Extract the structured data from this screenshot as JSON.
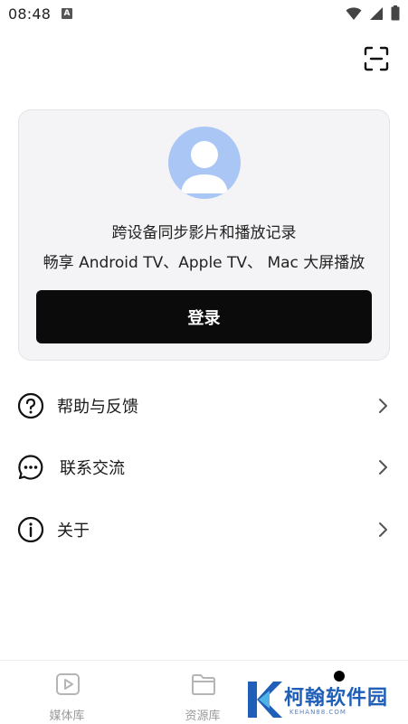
{
  "status_bar": {
    "time": "08:48",
    "notification_icon": "A"
  },
  "header": {
    "scan_icon": "scan-icon"
  },
  "login_card": {
    "line1": "跨设备同步影片和播放记录",
    "line2": "畅享 Android TV、Apple TV、 Mac 大屏播放",
    "login_label": "登录",
    "avatar_color": "#a9c6f5"
  },
  "menu": {
    "items": [
      {
        "label": "帮助与反馈",
        "icon": "help-circle-icon"
      },
      {
        "label": "联系交流",
        "icon": "chat-bubble-icon"
      },
      {
        "label": "关于",
        "icon": "info-circle-icon"
      }
    ]
  },
  "bottom_nav": {
    "items": [
      {
        "label": "媒体库",
        "icon": "play-icon"
      },
      {
        "label": "资源库",
        "icon": "folder-icon"
      }
    ]
  },
  "watermark": {
    "text": "柯翰软件园",
    "sub": "KEHAN88.COM",
    "brand_color": "#1f5fb8"
  }
}
